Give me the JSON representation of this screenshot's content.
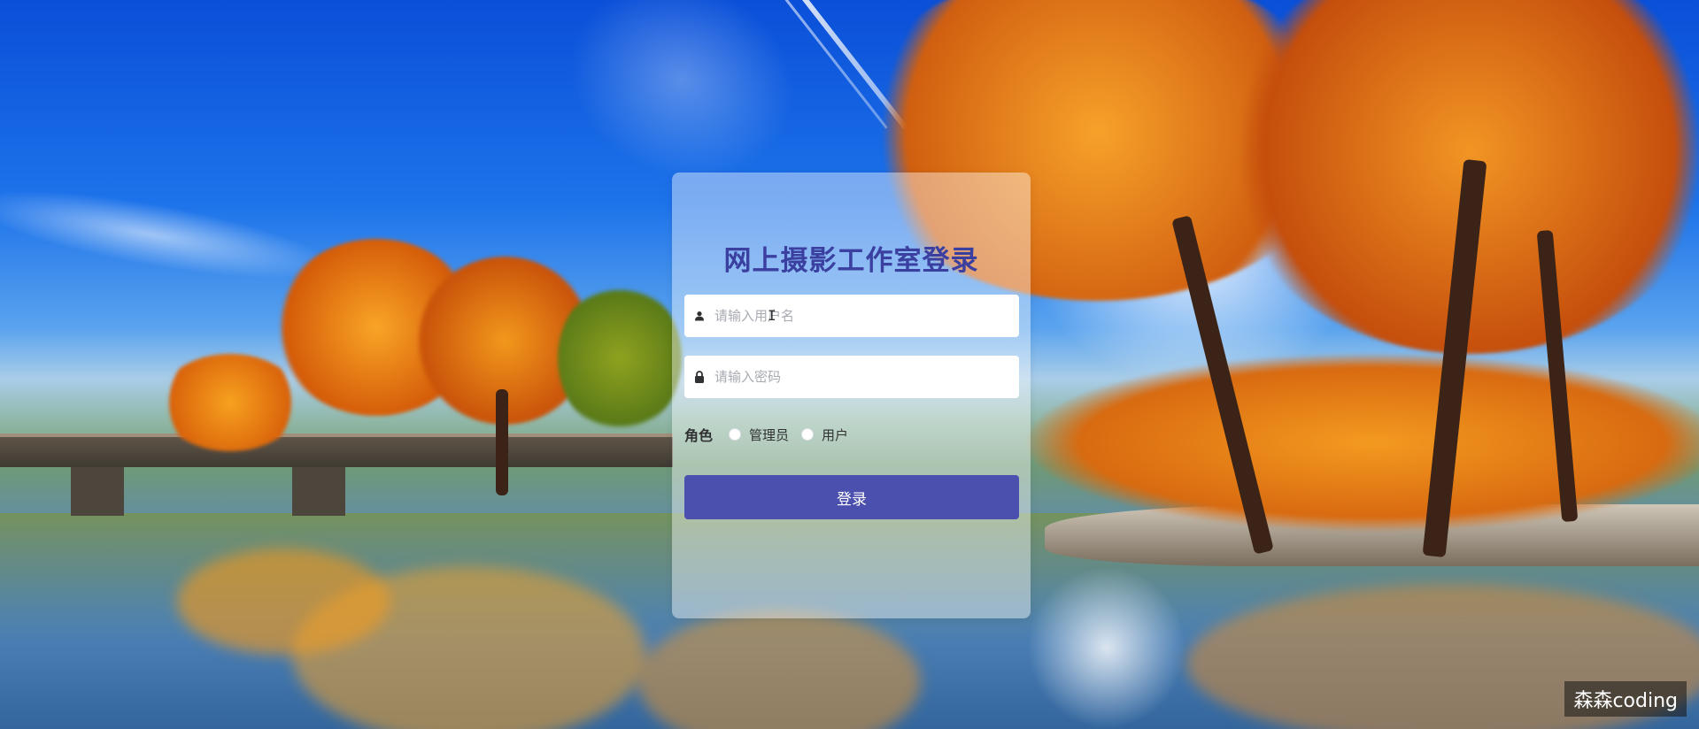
{
  "login": {
    "title": "网上摄影工作室登录",
    "username_placeholder": "请输入用户名",
    "password_placeholder": "请输入密码",
    "role_label": "角色",
    "role_options": [
      "管理员",
      "用户"
    ],
    "submit_label": "登录"
  },
  "watermark": "森森coding",
  "colors": {
    "title": "#3a3fa0",
    "button": "#4b4fad"
  },
  "icons": {
    "username": "user-icon",
    "password": "lock-icon"
  }
}
